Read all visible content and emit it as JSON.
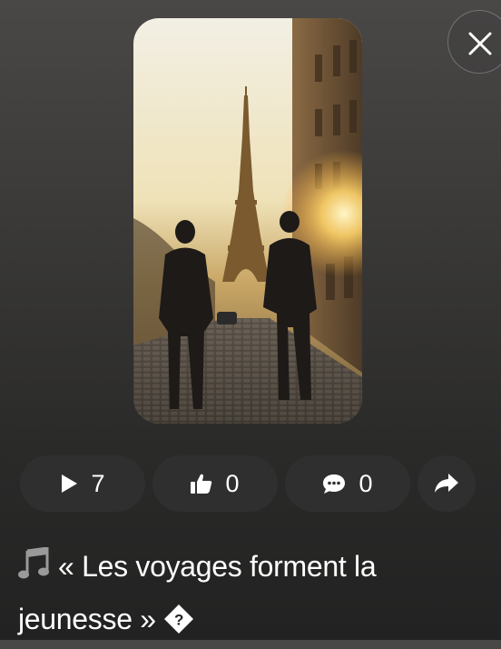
{
  "actions": {
    "plays": {
      "icon": "play-icon",
      "count": "7"
    },
    "likes": {
      "icon": "thumbs-up-icon",
      "count": "0"
    },
    "comments": {
      "icon": "comment-icon",
      "count": "0"
    },
    "share": {
      "icon": "share-icon"
    }
  },
  "close": {
    "icon": "close-icon"
  },
  "media": {
    "icon": "video-thumbnail"
  },
  "caption": {
    "icon": "music-notes-icon",
    "line1": "« Les voyages forment la",
    "line2": "jeunesse »",
    "trailing_icon": "question-diamond-icon"
  },
  "colors": {
    "pill_bg": "#2f2f30",
    "text": "#ffffff",
    "background_top": "#4a4846",
    "background_bottom": "#222222"
  }
}
